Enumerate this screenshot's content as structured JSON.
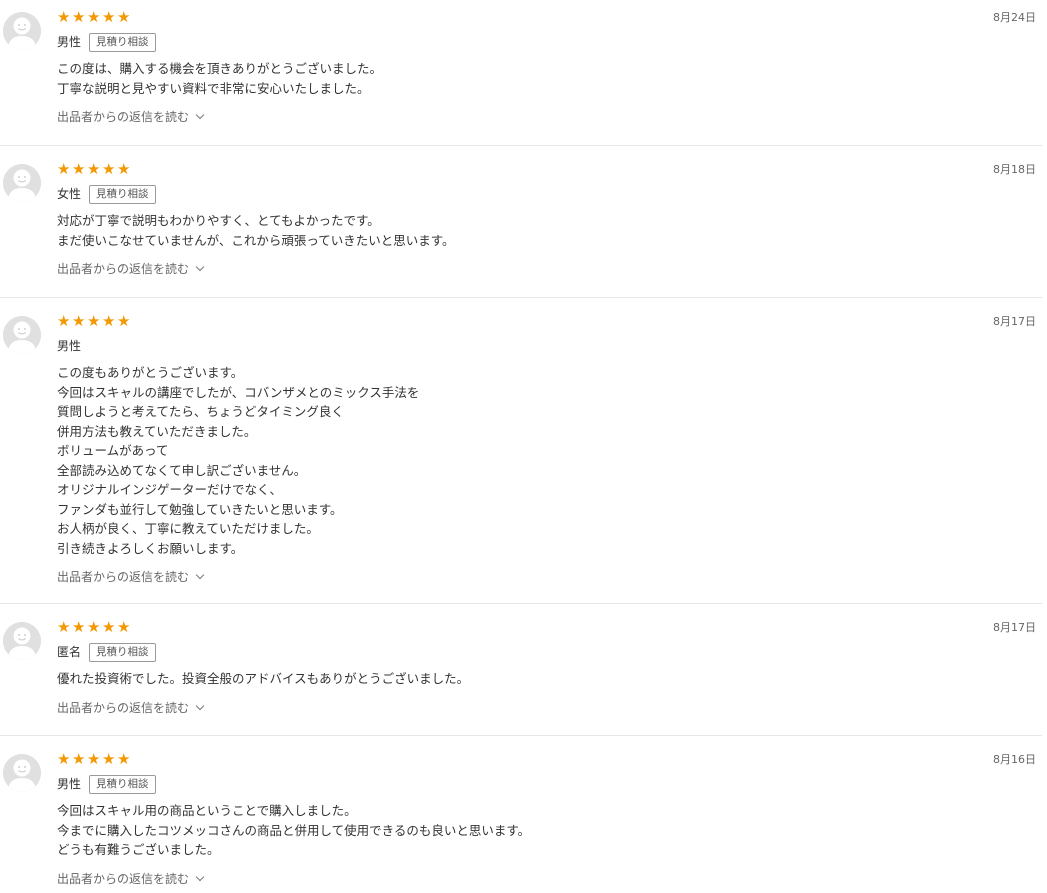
{
  "star_color": "#f39800",
  "reply_link_label": "出品者からの返信を読む",
  "reviews": [
    {
      "date": "8月24日",
      "rating": 5,
      "reviewer": "男性",
      "tag": "見積り相談",
      "lines": [
        "この度は、購入する機会を頂きありがとうございました。",
        "丁寧な説明と見やすい資料で非常に安心いたしました。"
      ]
    },
    {
      "date": "8月18日",
      "rating": 5,
      "reviewer": "女性",
      "tag": "見積り相談",
      "lines": [
        "対応が丁寧で説明もわかりやすく、とてもよかったです。",
        "まだ使いこなせていませんが、これから頑張っていきたいと思います。"
      ]
    },
    {
      "date": "8月17日",
      "rating": 5,
      "reviewer": "男性",
      "tag": "",
      "lines": [
        "この度もありがとうございます。",
        "今回はスキャルの講座でしたが、コバンザメとのミックス手法を",
        "質問しようと考えてたら、ちょうどタイミング良く",
        "併用方法も教えていただきました。",
        "ボリュームがあって",
        "全部読み込めてなくて申し訳ございません。",
        "オリジナルインジゲーターだけでなく、",
        "ファンダも並行して勉強していきたいと思います。",
        "お人柄が良く、丁寧に教えていただけました。",
        "引き続きよろしくお願いします。"
      ]
    },
    {
      "date": "8月17日",
      "rating": 5,
      "reviewer": "匿名",
      "tag": "見積り相談",
      "lines": [
        "優れた投資術でした。投資全般のアドバイスもありがとうございました。"
      ]
    },
    {
      "date": "8月16日",
      "rating": 5,
      "reviewer": "男性",
      "tag": "見積り相談",
      "lines": [
        "今回はスキャル用の商品ということで購入しました。",
        "今までに購入したコツメッコさんの商品と併用して使用できるのも良いと思います。",
        "どうも有難うございました。"
      ]
    }
  ]
}
